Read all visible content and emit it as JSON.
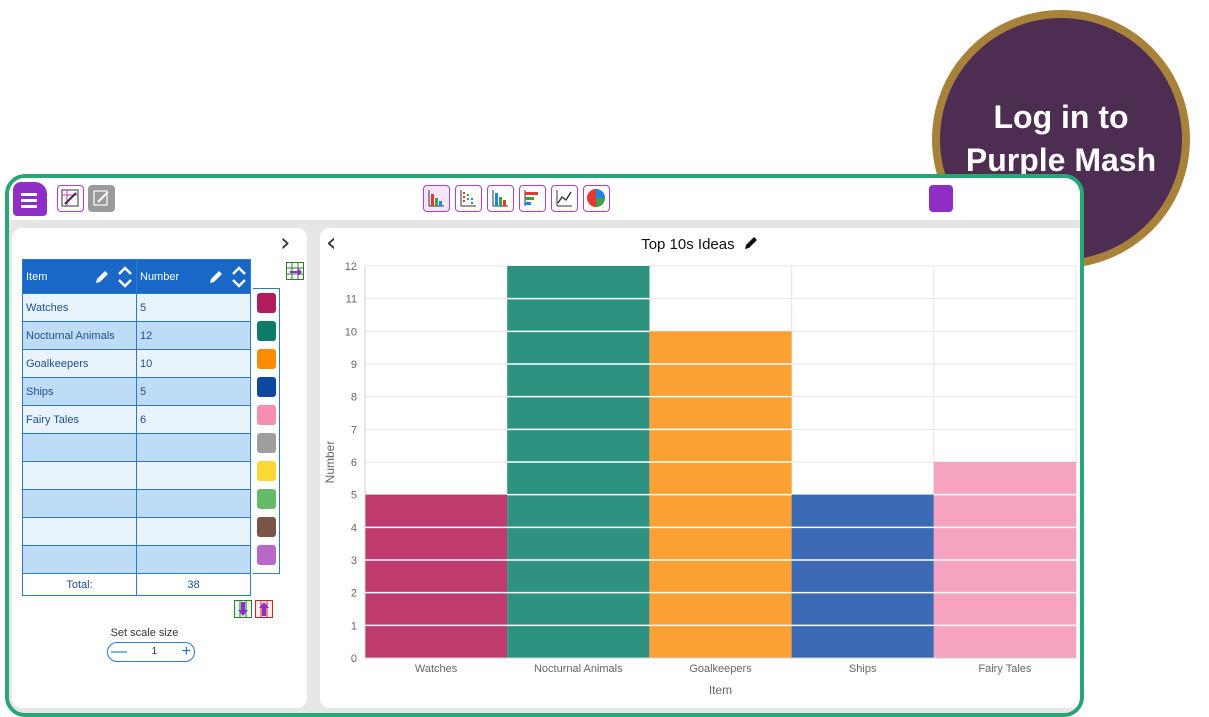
{
  "badge": {
    "line1": "Log in to",
    "line2": "Purple Mash"
  },
  "toolbar": {
    "chart_type_icons": [
      "bar-stacked-icon",
      "pictogram-icon",
      "bar-chart-icon",
      "horizontal-bar-icon",
      "line-chart-icon",
      "pie-chart-icon"
    ]
  },
  "table": {
    "headers": {
      "item": "Item",
      "number": "Number"
    },
    "rows": [
      {
        "item": "Watches",
        "number": "5",
        "color": "#b01f5c"
      },
      {
        "item": "Nocturnal Animals",
        "number": "12",
        "color": "#0c7b68"
      },
      {
        "item": "Goalkeepers",
        "number": "10",
        "color": "#fb8c00"
      },
      {
        "item": "Ships",
        "number": "5",
        "color": "#0d47a1"
      },
      {
        "item": "Fairy Tales",
        "number": "6",
        "color": "#f48fb1"
      },
      {
        "item": "",
        "number": "",
        "color": "#9e9e9e"
      },
      {
        "item": "",
        "number": "",
        "color": "#fdd835"
      },
      {
        "item": "",
        "number": "",
        "color": "#66bb6a"
      },
      {
        "item": "",
        "number": "",
        "color": "#795548"
      },
      {
        "item": "",
        "number": "",
        "color": "#ba68c8"
      }
    ],
    "total_label": "Total:",
    "total_value": "38"
  },
  "scale": {
    "label": "Set scale size",
    "value": "1",
    "minus": "—",
    "plus": "+"
  },
  "chart_data": {
    "type": "bar",
    "title": "Top 10s Ideas",
    "xlabel": "Item",
    "ylabel": "Number",
    "categories": [
      "Watches",
      "Nocturnal Animals",
      "Goalkeepers",
      "Ships",
      "Fairy Tales"
    ],
    "values": [
      5,
      12,
      10,
      5,
      6
    ],
    "colors": [
      "#bf3b6e",
      "#2e9281",
      "#fba033",
      "#3b69b3",
      "#f5a3bf"
    ],
    "ylim": [
      0,
      12
    ],
    "yticks": [
      "0",
      "1",
      "2",
      "3",
      "4",
      "5",
      "6",
      "7",
      "8",
      "9",
      "10",
      "11",
      "12"
    ],
    "grid": true,
    "legend": "none"
  }
}
